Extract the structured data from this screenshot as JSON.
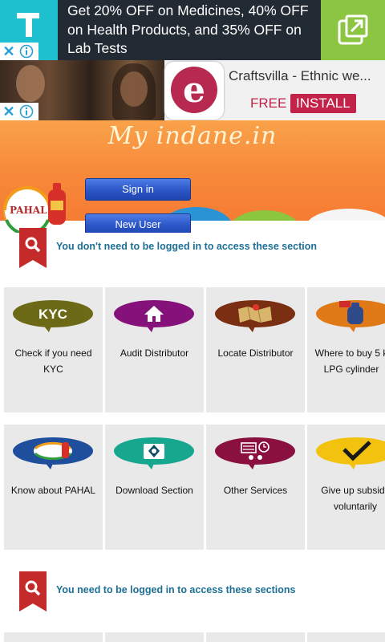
{
  "ads": {
    "ad1": {
      "text": "Get 20% OFF on Medicines, 40% OFF on Health Products, and 35% OFF on Lab Tests",
      "logo_icon": "1mg-logo-icon",
      "action_icon": "open-external-icon",
      "bg_color": "#222a33",
      "accent_color": "#8bc541"
    },
    "ad2": {
      "title": "Craftsvilla - Ethnic we...",
      "free_label": "FREE",
      "install_label": "INSTALL",
      "app_icon_letter": "e",
      "brand_color": "#c32249"
    }
  },
  "header": {
    "site_title": "My indane.in",
    "sign_in_label": "Sign in",
    "new_user_label": "New User",
    "pahal_logo_text": "PAHAL"
  },
  "sections": [
    {
      "label": "You don't need to be logged in to access these section",
      "tiles": [
        {
          "icon": "kyc-icon",
          "icon_text": "KYC",
          "caption": "Check if you need\nKYC",
          "color": "#6d6a17"
        },
        {
          "icon": "home-icon",
          "caption": "Audit Distributor",
          "color": "#84127a"
        },
        {
          "icon": "map-icon",
          "caption": "Locate Distributor",
          "color": "#7a2f12"
        },
        {
          "icon": "lpg-cylinder-icon",
          "caption": "Where to buy 5 k\nLPG cylinder",
          "color": "#e07a18"
        },
        {
          "icon": "pahal-icon",
          "caption": "Know about PAHAL",
          "color": "#1f4f9c"
        },
        {
          "icon": "download-icon",
          "caption": "Download Section",
          "color": "#17a68e"
        },
        {
          "icon": "services-icon",
          "caption": "Other Services",
          "color": "#8a1040"
        },
        {
          "icon": "checkmark-icon",
          "caption": "Give up subsidy\nvoluntarily",
          "color": "#f2c20f"
        }
      ]
    },
    {
      "label": "You need to be logged in to access these sections"
    }
  ]
}
